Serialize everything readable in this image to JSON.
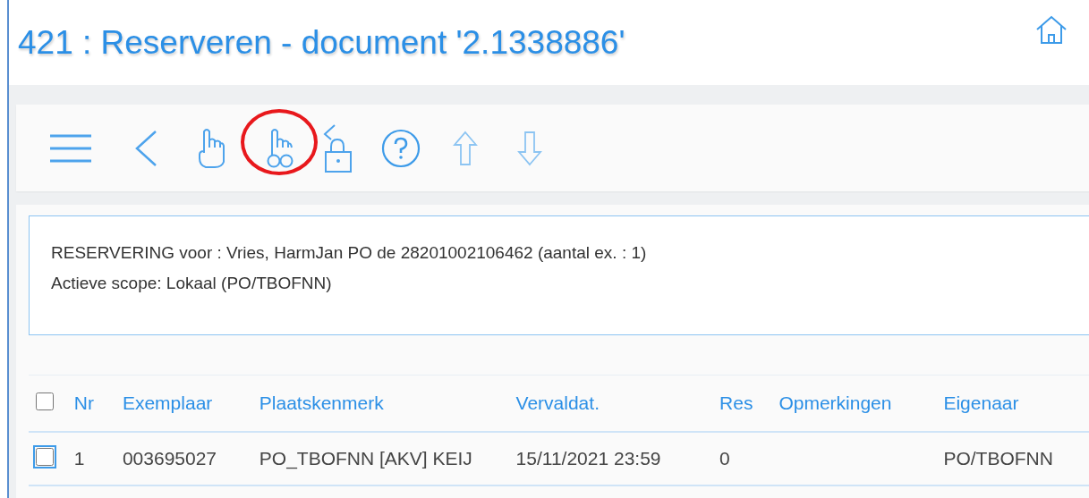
{
  "window": {
    "title": "421 : Reserveren - document '2.1338886'"
  },
  "toolbar": {
    "buttons": [
      {
        "kind": "menu"
      },
      {
        "kind": "back"
      },
      {
        "kind": "hand"
      },
      {
        "kind": "hand-rings",
        "highlighted": true
      },
      {
        "kind": "unlock"
      },
      {
        "kind": "help"
      },
      {
        "kind": "up"
      },
      {
        "kind": "down"
      }
    ]
  },
  "info": {
    "lines": [
      "RESERVERING voor : Vries, HarmJan PO de 28201002106462 (aantal ex. : 1)",
      "Actieve scope: Lokaal (PO/TBOFNN)"
    ]
  },
  "table": {
    "header_checked": false,
    "columns": [
      "Nr",
      "Exemplaar",
      "Plaatskenmerk",
      "Vervaldat.",
      "Res",
      "Opmerkingen",
      "Eigenaar"
    ],
    "rows": [
      {
        "checked": false,
        "cells": [
          "1",
          "003695027",
          "PO_TBOFNN [AKV] KEIJ",
          "15/11/2021 23:59",
          "0",
          "",
          "PO/TBOFNN"
        ]
      }
    ]
  }
}
